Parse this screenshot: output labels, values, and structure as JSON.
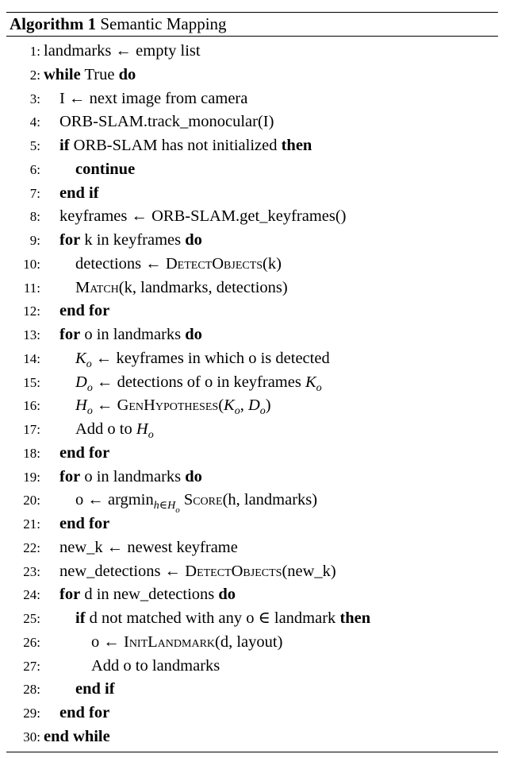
{
  "caption": {
    "label": "Algorithm 1",
    "title": "Semantic Mapping"
  },
  "lines": [
    {
      "n": "1:",
      "indent": 0,
      "parts": [
        {
          "t": "landmarks ← empty list"
        }
      ]
    },
    {
      "n": "2:",
      "indent": 0,
      "parts": [
        {
          "t": "while",
          "s": "kw"
        },
        {
          "t": " True "
        },
        {
          "t": "do",
          "s": "kw"
        }
      ]
    },
    {
      "n": "3:",
      "indent": 1,
      "parts": [
        {
          "t": "I ← next image from camera"
        }
      ]
    },
    {
      "n": "4:",
      "indent": 1,
      "parts": [
        {
          "t": "ORB-SLAM.track_monocular(I)"
        }
      ]
    },
    {
      "n": "5:",
      "indent": 1,
      "parts": [
        {
          "t": "if",
          "s": "kw"
        },
        {
          "t": " ORB-SLAM has not initialized "
        },
        {
          "t": "then",
          "s": "kw"
        }
      ]
    },
    {
      "n": "6:",
      "indent": 2,
      "parts": [
        {
          "t": "continue",
          "s": "kw"
        }
      ]
    },
    {
      "n": "7:",
      "indent": 1,
      "parts": [
        {
          "t": "end if",
          "s": "kw"
        }
      ]
    },
    {
      "n": "8:",
      "indent": 1,
      "parts": [
        {
          "t": "keyframes ← ORB-SLAM.get_keyframes()"
        }
      ]
    },
    {
      "n": "9:",
      "indent": 1,
      "parts": [
        {
          "t": "for",
          "s": "kw"
        },
        {
          "t": " k in keyframes "
        },
        {
          "t": "do",
          "s": "kw"
        }
      ]
    },
    {
      "n": "10:",
      "indent": 2,
      "parts": [
        {
          "t": "detections ← "
        },
        {
          "t": "DetectObjects",
          "s": "sc"
        },
        {
          "t": "(k)"
        }
      ]
    },
    {
      "n": "11:",
      "indent": 2,
      "parts": [
        {
          "t": "Match",
          "s": "sc"
        },
        {
          "t": "(k, landmarks, detections)"
        }
      ]
    },
    {
      "n": "12:",
      "indent": 1,
      "parts": [
        {
          "t": "end for",
          "s": "kw"
        }
      ]
    },
    {
      "n": "13:",
      "indent": 1,
      "parts": [
        {
          "t": "for",
          "s": "kw"
        },
        {
          "t": " o in landmarks "
        },
        {
          "t": "do",
          "s": "kw"
        }
      ]
    },
    {
      "n": "14:",
      "indent": 2,
      "parts": [
        {
          "t": "K",
          "s": "it"
        },
        {
          "t": "o",
          "s": "sub"
        },
        {
          "t": " ← keyframes in which o is detected"
        }
      ]
    },
    {
      "n": "15:",
      "indent": 2,
      "parts": [
        {
          "t": "D",
          "s": "it"
        },
        {
          "t": "o",
          "s": "sub"
        },
        {
          "t": " ← detections of o in keyframes "
        },
        {
          "t": "K",
          "s": "it"
        },
        {
          "t": "o",
          "s": "sub"
        }
      ]
    },
    {
      "n": "16:",
      "indent": 2,
      "parts": [
        {
          "t": "H",
          "s": "it"
        },
        {
          "t": "o",
          "s": "sub"
        },
        {
          "t": " ← "
        },
        {
          "t": "GenHypotheses",
          "s": "sc"
        },
        {
          "t": "("
        },
        {
          "t": "K",
          "s": "it"
        },
        {
          "t": "o",
          "s": "sub"
        },
        {
          "t": ", "
        },
        {
          "t": "D",
          "s": "it"
        },
        {
          "t": "o",
          "s": "sub"
        },
        {
          "t": ")"
        }
      ]
    },
    {
      "n": "17:",
      "indent": 2,
      "parts": [
        {
          "t": "Add o to "
        },
        {
          "t": "H",
          "s": "it"
        },
        {
          "t": "o",
          "s": "sub"
        }
      ]
    },
    {
      "n": "18:",
      "indent": 1,
      "parts": [
        {
          "t": "end for",
          "s": "kw"
        }
      ]
    },
    {
      "n": "19:",
      "indent": 1,
      "parts": [
        {
          "t": "for",
          "s": "kw"
        },
        {
          "t": " o in landmarks "
        },
        {
          "t": "do",
          "s": "kw"
        }
      ]
    },
    {
      "n": "20:",
      "indent": 2,
      "parts": [
        {
          "t": "o ← argmin"
        },
        {
          "t": "h∈H",
          "s": "sub"
        },
        {
          "t": "o",
          "s": "sub2"
        },
        {
          "t": " "
        },
        {
          "t": "Score",
          "s": "sc"
        },
        {
          "t": "(h, landmarks)"
        }
      ]
    },
    {
      "n": "21:",
      "indent": 1,
      "parts": [
        {
          "t": "end for",
          "s": "kw"
        }
      ]
    },
    {
      "n": "22:",
      "indent": 1,
      "parts": [
        {
          "t": "new_k ← newest keyframe"
        }
      ]
    },
    {
      "n": "23:",
      "indent": 1,
      "parts": [
        {
          "t": "new_detections ← "
        },
        {
          "t": "DetectObjects",
          "s": "sc"
        },
        {
          "t": "(new_k)"
        }
      ]
    },
    {
      "n": "24:",
      "indent": 1,
      "parts": [
        {
          "t": "for",
          "s": "kw"
        },
        {
          "t": " d in new_detections "
        },
        {
          "t": "do",
          "s": "kw"
        }
      ]
    },
    {
      "n": "25:",
      "indent": 2,
      "parts": [
        {
          "t": "if",
          "s": "kw"
        },
        {
          "t": " d not matched with any o ∈ landmark "
        },
        {
          "t": "then",
          "s": "kw"
        }
      ]
    },
    {
      "n": "26:",
      "indent": 3,
      "parts": [
        {
          "t": "o ← "
        },
        {
          "t": "InitLandmark",
          "s": "sc"
        },
        {
          "t": "(d, layout)"
        }
      ]
    },
    {
      "n": "27:",
      "indent": 3,
      "parts": [
        {
          "t": "Add o to landmarks"
        }
      ]
    },
    {
      "n": "28:",
      "indent": 2,
      "parts": [
        {
          "t": "end if",
          "s": "kw"
        }
      ]
    },
    {
      "n": "29:",
      "indent": 1,
      "parts": [
        {
          "t": "end for",
          "s": "kw"
        }
      ]
    },
    {
      "n": "30:",
      "indent": 0,
      "parts": [
        {
          "t": "end while",
          "s": "kw"
        }
      ]
    }
  ]
}
